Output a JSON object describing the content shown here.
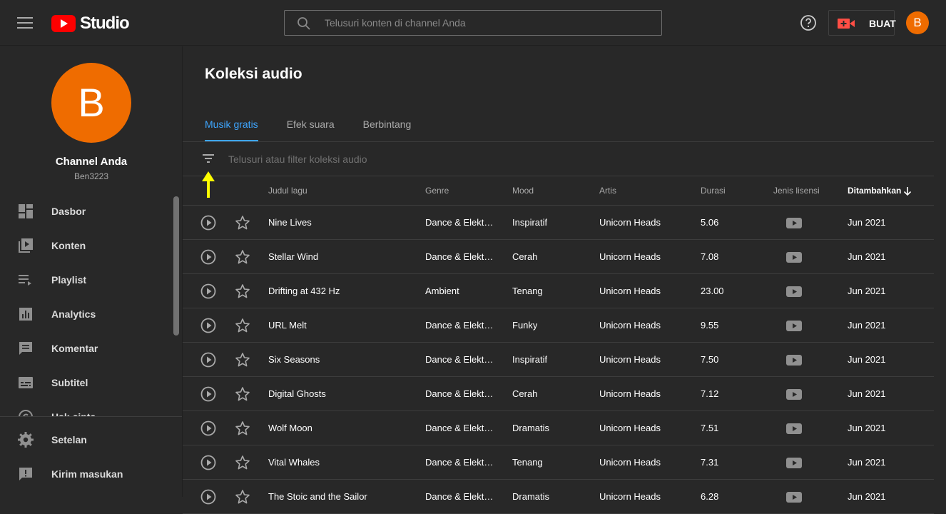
{
  "header": {
    "logo_text": "Studio",
    "search_placeholder": "Telusuri konten di channel Anda",
    "create_label": "BUAT",
    "avatar_letter": "B"
  },
  "sidebar": {
    "avatar_letter": "B",
    "channel_title": "Channel Anda",
    "channel_handle": "Ben3223",
    "items": [
      {
        "label": "Dasbor",
        "icon": "dashboard-icon"
      },
      {
        "label": "Konten",
        "icon": "content-icon"
      },
      {
        "label": "Playlist",
        "icon": "playlist-icon"
      },
      {
        "label": "Analytics",
        "icon": "analytics-icon"
      },
      {
        "label": "Komentar",
        "icon": "comments-icon"
      },
      {
        "label": "Subtitel",
        "icon": "subtitles-icon"
      },
      {
        "label": "Hak cipta",
        "icon": "copyright-icon"
      }
    ],
    "bottom_items": [
      {
        "label": "Setelan",
        "icon": "settings-icon"
      },
      {
        "label": "Kirim masukan",
        "icon": "feedback-icon"
      }
    ]
  },
  "main": {
    "title": "Koleksi audio",
    "tabs": [
      {
        "label": "Musik gratis",
        "active": true
      },
      {
        "label": "Efek suara",
        "active": false
      },
      {
        "label": "Berbintang",
        "active": false
      }
    ],
    "filter_placeholder": "Telusuri atau filter koleksi audio",
    "columns": {
      "title": "Judul lagu",
      "genre": "Genre",
      "mood": "Mood",
      "artist": "Artis",
      "duration": "Durasi",
      "license": "Jenis lisensi",
      "added": "Ditambahkan"
    },
    "rows": [
      {
        "title": "Nine Lives",
        "genre": "Dance & Elekt…",
        "mood": "Inspiratif",
        "artist": "Unicorn Heads",
        "duration": "5.06",
        "added": "Jun 2021"
      },
      {
        "title": "Stellar Wind",
        "genre": "Dance & Elekt…",
        "mood": "Cerah",
        "artist": "Unicorn Heads",
        "duration": "7.08",
        "added": "Jun 2021"
      },
      {
        "title": "Drifting at 432 Hz",
        "genre": "Ambient",
        "mood": "Tenang",
        "artist": "Unicorn Heads",
        "duration": "23.00",
        "added": "Jun 2021"
      },
      {
        "title": "URL Melt",
        "genre": "Dance & Elekt…",
        "mood": "Funky",
        "artist": "Unicorn Heads",
        "duration": "9.55",
        "added": "Jun 2021"
      },
      {
        "title": "Six Seasons",
        "genre": "Dance & Elekt…",
        "mood": "Inspiratif",
        "artist": "Unicorn Heads",
        "duration": "7.50",
        "added": "Jun 2021"
      },
      {
        "title": "Digital Ghosts",
        "genre": "Dance & Elekt…",
        "mood": "Cerah",
        "artist": "Unicorn Heads",
        "duration": "7.12",
        "added": "Jun 2021"
      },
      {
        "title": "Wolf Moon",
        "genre": "Dance & Elekt…",
        "mood": "Dramatis",
        "artist": "Unicorn Heads",
        "duration": "7.51",
        "added": "Jun 2021"
      },
      {
        "title": "Vital Whales",
        "genre": "Dance & Elekt…",
        "mood": "Tenang",
        "artist": "Unicorn Heads",
        "duration": "7.31",
        "added": "Jun 2021"
      },
      {
        "title": "The Stoic and the Sailor",
        "genre": "Dance & Elekt…",
        "mood": "Dramatis",
        "artist": "Unicorn Heads",
        "duration": "6.28",
        "added": "Jun 2021"
      }
    ]
  },
  "colors": {
    "background": "#282828",
    "accent": "#3ea6ff",
    "avatar": "#ef6c00",
    "brand_red": "#ff0000",
    "hint_arrow": "#ffff00"
  }
}
